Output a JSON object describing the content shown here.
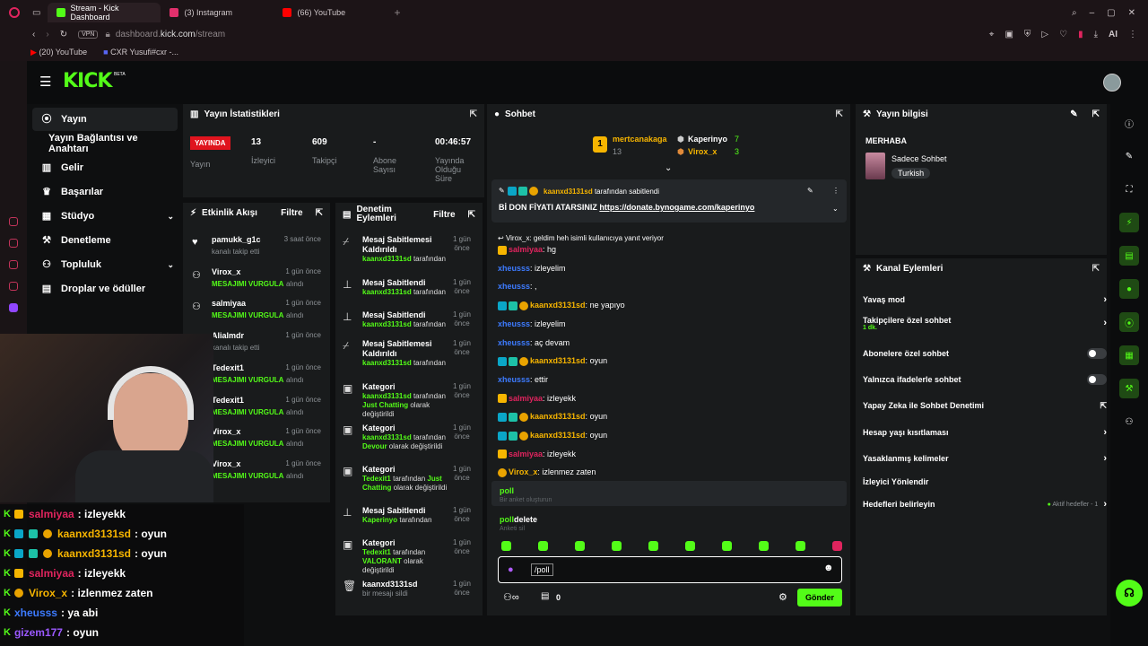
{
  "browser": {
    "tabs": [
      {
        "label": "Stream - Kick Dashboard",
        "active": true,
        "color": "#53fc18"
      },
      {
        "label": "(3) Instagram",
        "active": false,
        "color": "#e1306c"
      },
      {
        "label": "(66) YouTube",
        "active": false,
        "color": "#ff0000"
      }
    ],
    "url_host": "dashboard.",
    "url_domain": "kick.com",
    "url_path": "/stream",
    "vpn": "VPN",
    "ai_label": "AI",
    "bookmarks": [
      "(20) YouTube",
      "CXR Yusufi#cxr -..."
    ]
  },
  "kick": {
    "logo": "KICK",
    "beta": "BETA"
  },
  "nav": [
    {
      "label": "Yayın",
      "icon": "broadcast-icon",
      "active": true
    },
    {
      "label": "Yayın Bağlantısı ve Anahtarı",
      "icon": "",
      "active": false
    },
    {
      "label": "Gelir",
      "icon": "chart-icon",
      "active": false
    },
    {
      "label": "Başarılar",
      "icon": "trophy-icon",
      "active": false
    },
    {
      "label": "Stüdyo",
      "icon": "grid-icon",
      "active": false,
      "expand": true
    },
    {
      "label": "Denetleme",
      "icon": "wrench-icon",
      "active": false
    },
    {
      "label": "Topluluk",
      "icon": "people-icon",
      "active": false,
      "expand": true
    },
    {
      "label": "Droplar ve ödüller",
      "icon": "gift-icon",
      "active": false
    }
  ],
  "stats": {
    "title": "Yayın İstatistikleri",
    "live_badge": "YAYINDA",
    "live_label": "Yayın",
    "viewers": "13",
    "viewers_label": "İzleyici",
    "followers": "609",
    "followers_label": "Takipçi",
    "subs": "-",
    "subs_label": "Abone Sayısı",
    "uptime": "00:46:57",
    "uptime_label": "Yayında Olduğu Süre"
  },
  "activity": {
    "title": "Etkinlik Akışı",
    "filter": "Filtre",
    "items": [
      {
        "name": "pamukk_g1c",
        "sub": "kanalı takip etti",
        "time": "3 saat önce",
        "highlight": false
      },
      {
        "name": "Virox_x",
        "sub": "MESAJIMI VURGULA",
        "sub2": "alındı",
        "time": "1 gün önce",
        "highlight": true
      },
      {
        "name": "salmiyaa",
        "sub": "MESAJIMI VURGULA",
        "sub2": "alındı",
        "time": "1 gün önce",
        "highlight": true
      },
      {
        "name": "Alialmdr",
        "sub": "kanalı takip etti",
        "time": "1 gün önce",
        "highlight": false
      },
      {
        "name": "Tedexit1",
        "sub": "MESAJIMI VURGULA",
        "sub2": "alındı",
        "time": "1 gün önce",
        "highlight": true
      },
      {
        "name": "Tedexit1",
        "sub": "MESAJIMI VURGULA",
        "sub2": "alındı",
        "time": "1 gün önce",
        "highlight": true
      },
      {
        "name": "Virox_x",
        "sub": "MESAJIMI VURGULA",
        "sub2": "alındı",
        "time": "1 gün önce",
        "highlight": true
      },
      {
        "name": "Virox_x",
        "sub": "MESAJIMI VURGULA",
        "sub2": "alındı",
        "time": "1 gün önce",
        "highlight": true
      }
    ]
  },
  "modlog": {
    "title": "Denetim Eylemleri",
    "filter": "Filtre",
    "items": [
      {
        "title": "Mesaj Sabitlemesi Kaldırıldı",
        "user": "kaanxd3131sd",
        "rest": "tarafından",
        "time": "1 gün önce"
      },
      {
        "title": "Mesaj Sabitlendi",
        "user": "kaanxd3131sd",
        "rest": "tarafından",
        "time": "1 gün önce"
      },
      {
        "title": "Mesaj Sabitlendi",
        "user": "kaanxd3131sd",
        "rest": "tarafından",
        "time": "1 gün önce"
      },
      {
        "title": "Mesaj Sabitlemesi Kaldırıldı",
        "user": "kaanxd3131sd",
        "rest": "tarafından",
        "time": "1 gün önce"
      },
      {
        "title": "Kategori",
        "user": "kaanxd3131sd",
        "rest": "tarafından",
        "cat": "Just Chatting",
        "tail": "olarak değiştirildi",
        "time": "1 gün önce"
      },
      {
        "title": "Kategori",
        "user": "kaanxd3131sd",
        "rest": "tarafından",
        "cat": "Devour",
        "tail": "olarak değiştirildi",
        "time": "1 gün önce"
      },
      {
        "title": "Kategori",
        "user": "Tedexit1",
        "rest": "tarafından",
        "cat": "Just Chatting",
        "tail": "olarak değiştirildi",
        "time": "1 gün önce"
      },
      {
        "title": "Mesaj Sabitlendi",
        "user": "Kaperinyo",
        "rest": "tarafından",
        "time": "1 gün önce"
      },
      {
        "title": "Kategori",
        "user": "Tedexit1",
        "rest": "tarafından",
        "cat": "VALORANT",
        "tail": "olarak değiştirildi",
        "time": "1 gün önce"
      },
      {
        "title": "kaanxd3131sd",
        "user": "",
        "rest": "bir mesajı sildi",
        "time": "1 gün önce"
      }
    ]
  },
  "chat": {
    "title": "Sohbet",
    "top": [
      {
        "name": "mertcanakaga",
        "count": "13"
      },
      {
        "name": "Kaperinyo",
        "count": "7"
      },
      {
        "name": "Virox_x",
        "count": "3"
      }
    ],
    "pinned_by": "kaanxd3131sd",
    "pinned_by_rest": "tarafından sabitlendi",
    "pinned_text": "Bİ DON FİYATI ATARSINIZ",
    "pinned_link": "https://donate.bynogame.com/kaperinyo",
    "reply_hint": "Virox_x: geldim heh isimli kullanıcıya yanıt veriyor",
    "messages": [
      {
        "user": "salmiyaa",
        "color": "#e0245e",
        "text": "hg",
        "badges": "crown"
      },
      {
        "user": "xheusss",
        "color": "#3d7bff",
        "text": "izleyelim",
        "badges": ""
      },
      {
        "user": "xheusss",
        "color": "#3d7bff",
        "text": ",",
        "badges": ""
      },
      {
        "user": "kaanxd3131sd",
        "color": "#f7b500",
        "text": "ne yapıyo",
        "badges": "full"
      },
      {
        "user": "xheusss",
        "color": "#3d7bff",
        "text": "izleyelim",
        "badges": ""
      },
      {
        "user": "xheusss",
        "color": "#3d7bff",
        "text": "aç devam",
        "badges": ""
      },
      {
        "user": "kaanxd3131sd",
        "color": "#f7b500",
        "text": "oyun",
        "badges": "full"
      },
      {
        "user": "xheusss",
        "color": "#3d7bff",
        "text": "ettir",
        "badges": ""
      },
      {
        "user": "salmiyaa",
        "color": "#e0245e",
        "text": "izleyekk",
        "badges": "crown"
      },
      {
        "user": "kaanxd3131sd",
        "color": "#f7b500",
        "text": "oyun",
        "badges": "full"
      },
      {
        "user": "kaanxd3131sd",
        "color": "#f7b500",
        "text": "oyun",
        "badges": "full"
      },
      {
        "user": "salmiyaa",
        "color": "#e0245e",
        "text": "izleyekk",
        "badges": "crown"
      },
      {
        "user": "Virox_x",
        "color": "#f7b500",
        "text": "izlenmez zaten",
        "badges": "coin"
      }
    ],
    "suggestions": [
      {
        "cmd": "poll",
        "desc": "Bir anket oluşturun"
      },
      {
        "cmd": "poll",
        "cmd2": "delete",
        "desc": "Anketi sil"
      }
    ],
    "input_value": "/poll",
    "count_label": "0",
    "send": "Gönder"
  },
  "info": {
    "title": "Yayın bilgisi",
    "stream_title": "MERHABA",
    "category": "Sadece Sohbet",
    "language": "Turkish"
  },
  "actions": {
    "title": "Kanal Eylemleri",
    "items": [
      {
        "label": "Yavaş mod",
        "ctrl": "arrow"
      },
      {
        "label": "Takipçilere özel sohbet",
        "ctrl": "arrow",
        "sub": "1 dk."
      },
      {
        "label": "Abonelere özel sohbet",
        "ctrl": "toggle"
      },
      {
        "label": "Yalnızca ifadelerle sohbet",
        "ctrl": "toggle"
      },
      {
        "label": "Yapay Zeka ile Sohbet Denetimi",
        "ctrl": "ext"
      },
      {
        "label": "Hesap yaşı kısıtlaması",
        "ctrl": "arrow"
      },
      {
        "label": "Yasaklanmış kelimeler",
        "ctrl": "arrow"
      },
      {
        "label": "İzleyici Yönlendir",
        "ctrl": ""
      },
      {
        "label": "Hedefleri belirleyin",
        "ctrl": "arrow",
        "extra": "Aktif hedefler - 1"
      }
    ]
  },
  "overlay_chat": [
    {
      "user": "salmiyaa",
      "color": "#e0245e",
      "text": ": izleyekk"
    },
    {
      "user": "kaanxd3131sd",
      "color": "#f7b500",
      "text": ": oyun"
    },
    {
      "user": "kaanxd3131sd",
      "color": "#f7b500",
      "text": ": oyun"
    },
    {
      "user": "salmiyaa",
      "color": "#e0245e",
      "text": ": izleyekk"
    },
    {
      "user": "Virox_x",
      "color": "#f7b500",
      "text": ": izlenmez zaten"
    },
    {
      "user": "xheusss",
      "color": "#3d7bff",
      "text": ": ya abi"
    },
    {
      "user": "gizem177",
      "color": "#9b59ff",
      "text": ": oyun"
    }
  ]
}
